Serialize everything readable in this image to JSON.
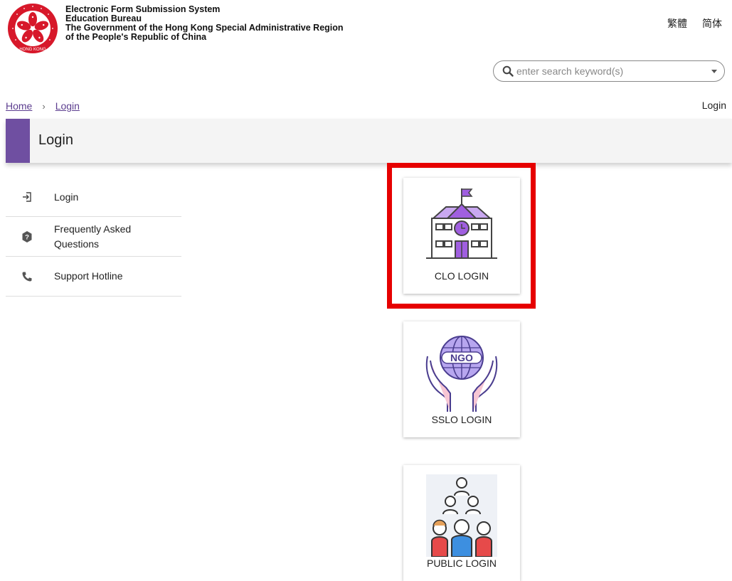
{
  "header": {
    "org_lines": [
      "Electronic Form Submission System",
      "Education Bureau",
      "The Government of the Hong Kong Special Administrative Region",
      "of the People's Republic of China"
    ],
    "emblem_text": "HONG KONG",
    "lang_tc": "繁體",
    "lang_sc": "简体",
    "search_placeholder": "enter search keyword(s)",
    "search_icon": "search-icon",
    "dropdown_icon": "chevron-down-icon"
  },
  "breadcrumb": {
    "home": "Home",
    "current": "Login",
    "separator": "›"
  },
  "top_right_link": "Login",
  "page_title": "Login",
  "sidebar": {
    "items": [
      {
        "label": "Login",
        "icon": "login-icon"
      },
      {
        "label": "Frequently Asked Questions",
        "icon": "help-icon"
      },
      {
        "label": "Support Hotline",
        "icon": "phone-icon"
      }
    ]
  },
  "cards": [
    {
      "label": "CLO LOGIN",
      "icon": "school-icon",
      "highlighted": true
    },
    {
      "label": "SSLO LOGIN",
      "icon": "ngo-icon",
      "badge": "NGO"
    },
    {
      "label": "PUBLIC LOGIN",
      "icon": "people-icon"
    }
  ],
  "colors": {
    "accent": "#6f4fa1",
    "link": "#5c3d8f",
    "highlight": "#e60000",
    "emblem": "#d7182a"
  }
}
